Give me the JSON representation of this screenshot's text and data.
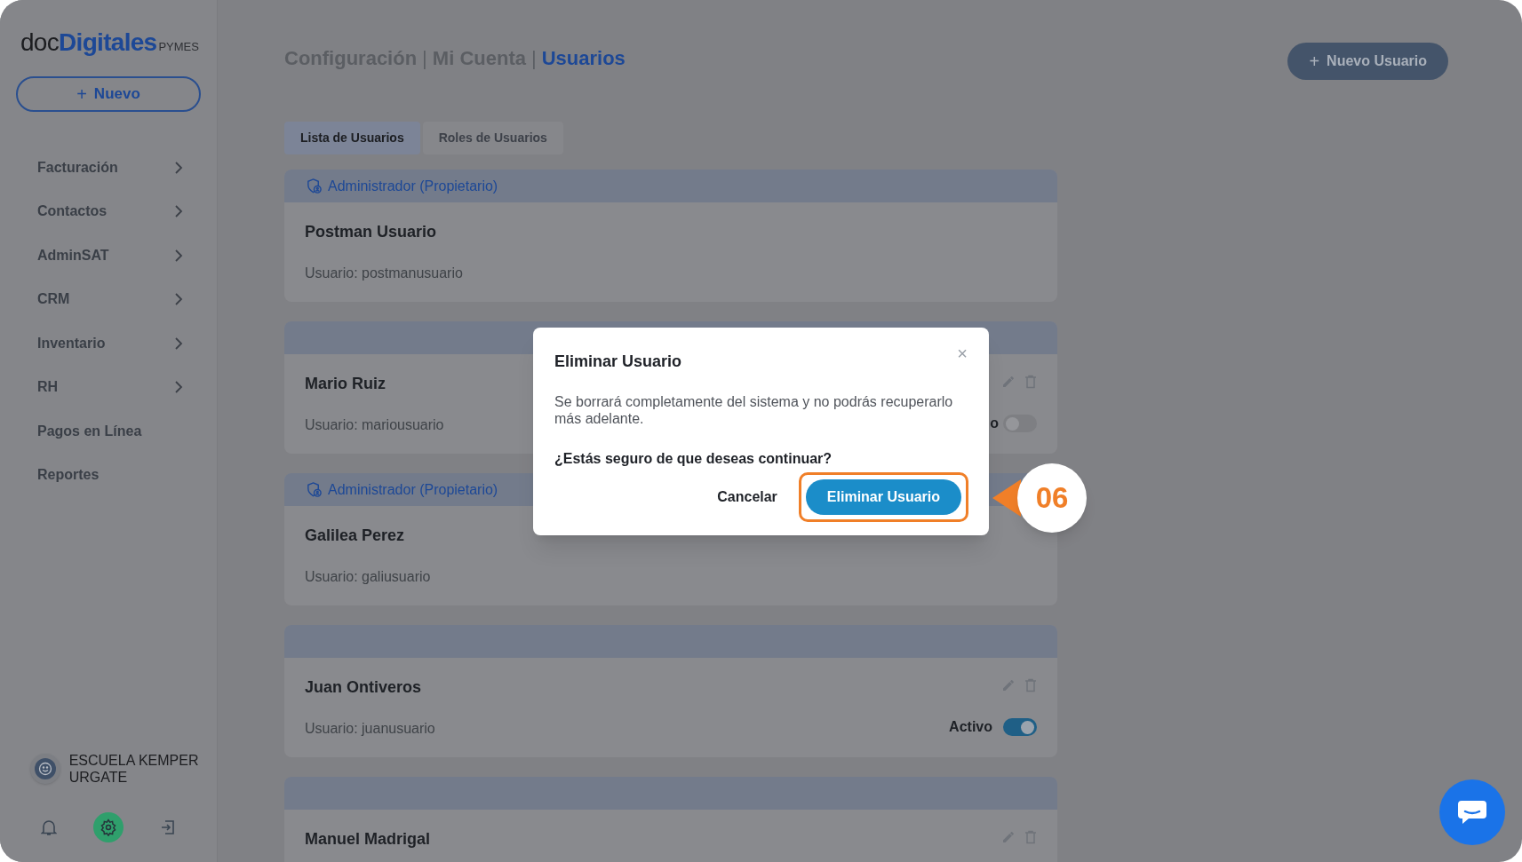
{
  "sidebar": {
    "logo": {
      "prefix": "doc",
      "name": "Digitales",
      "suffix": "PYMES"
    },
    "new_button": {
      "icon": "+",
      "label": "Nuevo"
    },
    "items": [
      {
        "label": "Facturación",
        "has_submenu": true
      },
      {
        "label": "Contactos",
        "has_submenu": true
      },
      {
        "label": "AdminSAT",
        "has_submenu": true
      },
      {
        "label": "CRM",
        "has_submenu": true
      },
      {
        "label": "Inventario",
        "has_submenu": true
      },
      {
        "label": "RH",
        "has_submenu": true
      },
      {
        "label": "Pagos en Línea",
        "has_submenu": false
      },
      {
        "label": "Reportes",
        "has_submenu": false
      }
    ],
    "account": {
      "name": "ESCUELA KEMPER URGATE"
    },
    "footer_icons": [
      {
        "kind": "bell",
        "selected": false
      },
      {
        "kind": "gear",
        "selected": true
      },
      {
        "kind": "logout",
        "selected": false
      }
    ]
  },
  "header": {
    "breadcrumb": [
      {
        "label": "Configuración",
        "current": false
      },
      {
        "label": "Mi Cuenta",
        "current": false
      },
      {
        "label": "Usuarios",
        "current": true
      }
    ],
    "separator": "|",
    "new_user_button": {
      "icon": "+",
      "label": "Nuevo Usuario"
    }
  },
  "tabs": [
    {
      "label": "Lista de Usuarios",
      "selected": true
    },
    {
      "label": "Roles de Usuarios",
      "selected": false
    }
  ],
  "users": [
    {
      "role": "Administrador (Propietario)",
      "name": "Postman Usuario",
      "username": "Usuario: postmanusuario",
      "actions": false
    },
    {
      "name": "Mario Ruiz",
      "username": "Usuario: mariousuario",
      "actions": true,
      "status": "o",
      "on": false
    },
    {
      "role": "Administrador (Propietario)",
      "name": "Galilea Perez",
      "username": "Usuario: galiusuario",
      "actions": false
    },
    {
      "name": "Juan Ontiveros",
      "username": "Usuario: juanusuario",
      "actions": true,
      "status": "Activo",
      "on": true
    },
    {
      "name": "Manuel Madrigal",
      "actions": true
    }
  ],
  "dialog": {
    "title": "Eliminar Usuario",
    "close": "×",
    "message": "Se borrará completamente del sistema y no podrás recuperarlo más adelante.",
    "question": "¿Estás seguro de que deseas continuar?",
    "cancel": "Cancelar",
    "confirm": "Eliminar Usuario"
  },
  "callout": {
    "label": "06"
  }
}
